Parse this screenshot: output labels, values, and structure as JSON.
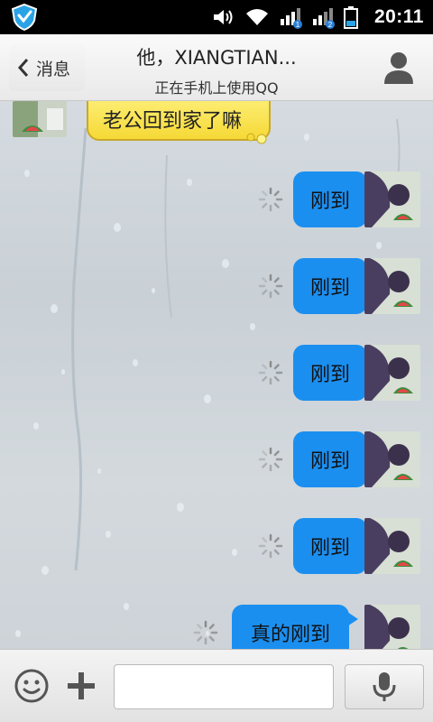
{
  "status_bar": {
    "time": "20:11",
    "icons": [
      "shield-icon",
      "volume-icon",
      "wifi-icon",
      "signal-sim1-icon",
      "signal-sim2-icon",
      "battery-icon"
    ],
    "sim1_badge": "1",
    "sim2_badge": "2"
  },
  "header": {
    "back_label": "消息",
    "title": "他，XIANGTIAN...",
    "subtitle": "正在手机上使用QQ"
  },
  "messages": [
    {
      "direction": "in",
      "text": "老公回到家了嘛"
    },
    {
      "direction": "out",
      "text": "刚到",
      "status": "sending"
    },
    {
      "direction": "out",
      "text": "刚到",
      "status": "sending"
    },
    {
      "direction": "out",
      "text": "刚到",
      "status": "sending"
    },
    {
      "direction": "out",
      "text": "刚到",
      "status": "sending"
    },
    {
      "direction": "out",
      "text": "刚到",
      "status": "sending"
    },
    {
      "direction": "out",
      "text": "真的刚到",
      "status": "sending"
    }
  ],
  "input": {
    "value": "",
    "placeholder": ""
  },
  "colors": {
    "outgoing_bubble": "#1b8ff0",
    "incoming_bubble": "#f6d936",
    "status_bar": "#000000"
  }
}
